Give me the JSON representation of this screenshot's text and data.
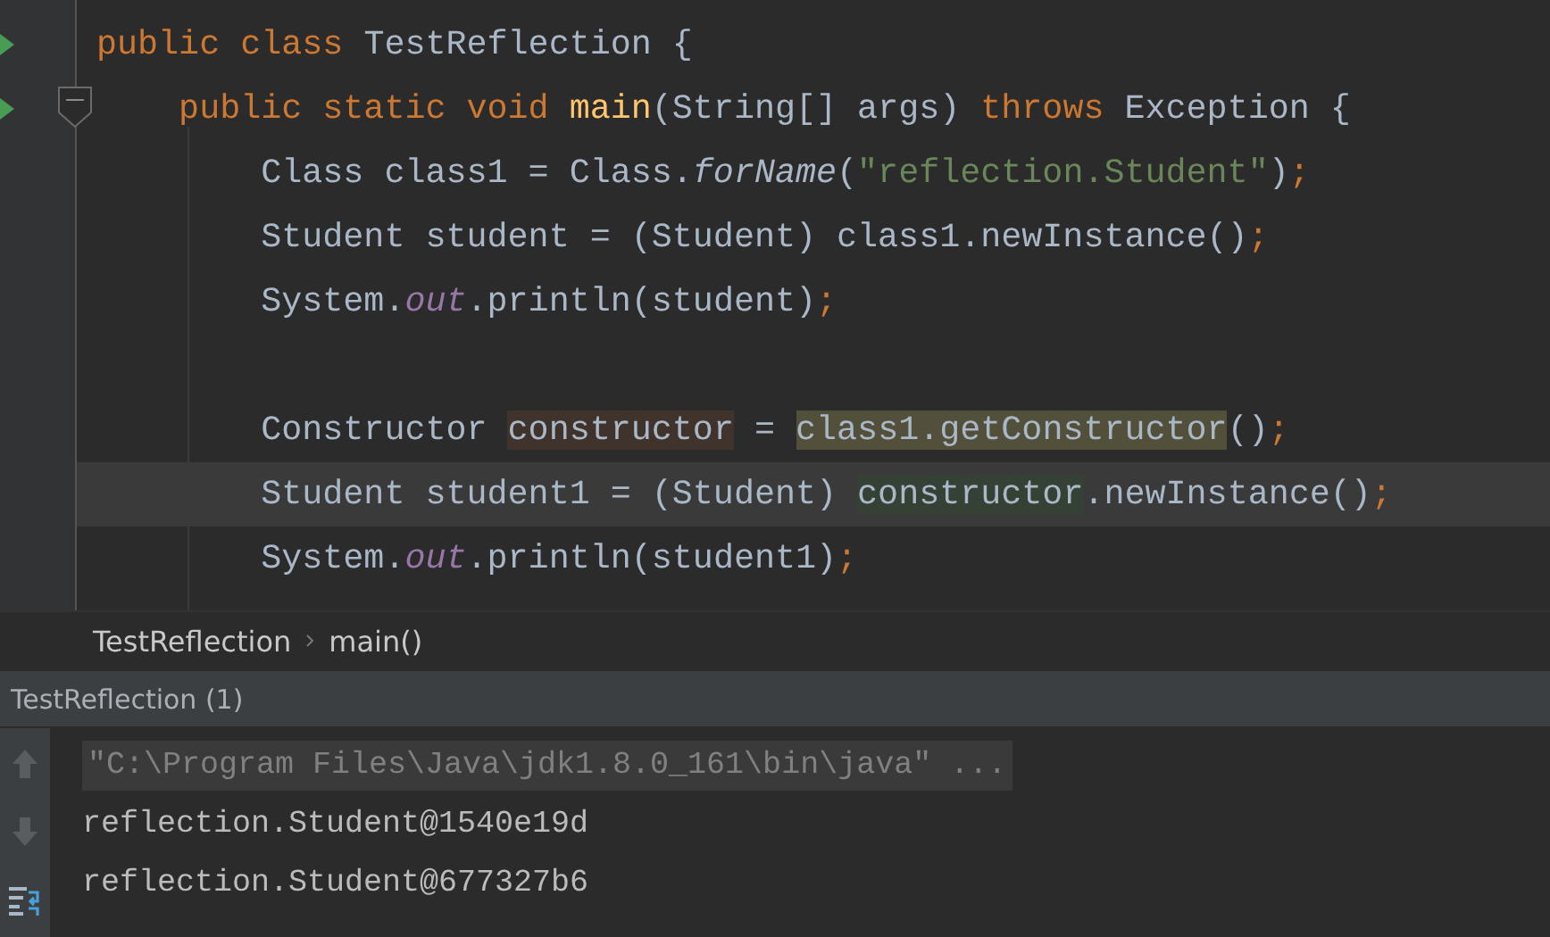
{
  "editor": {
    "lines": [
      {
        "run_marker": true,
        "fold_marker": false,
        "current": false,
        "tokens": [
          {
            "text": "public class ",
            "kind": "keyword"
          },
          {
            "text": "TestReflection {",
            "kind": "plain"
          }
        ]
      },
      {
        "run_marker": true,
        "fold_marker": true,
        "current": false,
        "tokens": [
          {
            "text": "    public static void ",
            "kind": "keyword"
          },
          {
            "text": "main",
            "kind": "method"
          },
          {
            "text": "(String[] args) ",
            "kind": "plain"
          },
          {
            "text": "throws ",
            "kind": "keyword"
          },
          {
            "text": "Exception {",
            "kind": "plain"
          }
        ]
      },
      {
        "run_marker": false,
        "fold_marker": false,
        "current": false,
        "tokens": [
          {
            "text": "        Class class1 = Class.",
            "kind": "plain"
          },
          {
            "text": "forName",
            "kind": "static"
          },
          {
            "text": "(",
            "kind": "plain"
          },
          {
            "text": "\"reflection.Student\"",
            "kind": "string"
          },
          {
            "text": ")",
            "kind": "plain"
          },
          {
            "text": ";",
            "kind": "punct"
          }
        ]
      },
      {
        "run_marker": false,
        "fold_marker": false,
        "current": false,
        "tokens": [
          {
            "text": "        Student student = (Student) class1.newInstance()",
            "kind": "plain"
          },
          {
            "text": ";",
            "kind": "punct"
          }
        ]
      },
      {
        "run_marker": false,
        "fold_marker": false,
        "current": false,
        "tokens": [
          {
            "text": "        System.",
            "kind": "plain"
          },
          {
            "text": "out",
            "kind": "field"
          },
          {
            "text": ".println(student)",
            "kind": "plain"
          },
          {
            "text": ";",
            "kind": "punct"
          }
        ]
      },
      {
        "run_marker": false,
        "fold_marker": false,
        "current": false
      },
      {
        "run_marker": false,
        "fold_marker": false,
        "current": false,
        "tokens": [
          {
            "text": "        Constructor ",
            "kind": "plain"
          },
          {
            "text": "constructor",
            "kind": "plain",
            "color": "#40332b"
          },
          {
            "text": " = ",
            "kind": "plain"
          },
          {
            "text": "class1.getConstructor",
            "kind": "plain",
            "color": "#52503a"
          },
          {
            "text": "()",
            "kind": "plain"
          },
          {
            "text": ";",
            "kind": "punct"
          }
        ]
      },
      {
        "run_marker": false,
        "fold_marker": false,
        "current": true,
        "tokens": [
          {
            "text": "        Student student1 = (Student) ",
            "kind": "plain"
          },
          {
            "text": "constructor",
            "kind": "plain",
            "color": "#344134"
          },
          {
            "text": ".newInstance()",
            "kind": "plain"
          },
          {
            "text": ";",
            "kind": "punct"
          }
        ]
      },
      {
        "run_marker": false,
        "fold_marker": false,
        "current": false,
        "tokens": [
          {
            "text": "        System.",
            "kind": "plain"
          },
          {
            "text": "out",
            "kind": "field"
          },
          {
            "text": ".println(student1)",
            "kind": "plain"
          },
          {
            "text": ";",
            "kind": "punct"
          }
        ]
      }
    ]
  },
  "breadcrumbs": [
    "TestReflection",
    "main()"
  ],
  "run_panel": {
    "tab": "TestReflection (1)",
    "console": [
      {
        "text": "\"C:\\Program Files\\Java\\jdk1.8.0_161\\bin\\java\" ...",
        "kind": "command"
      },
      {
        "text": "reflection.Student@1540e19d",
        "kind": "output"
      },
      {
        "text": "reflection.Student@677327b6",
        "kind": "output"
      }
    ]
  }
}
